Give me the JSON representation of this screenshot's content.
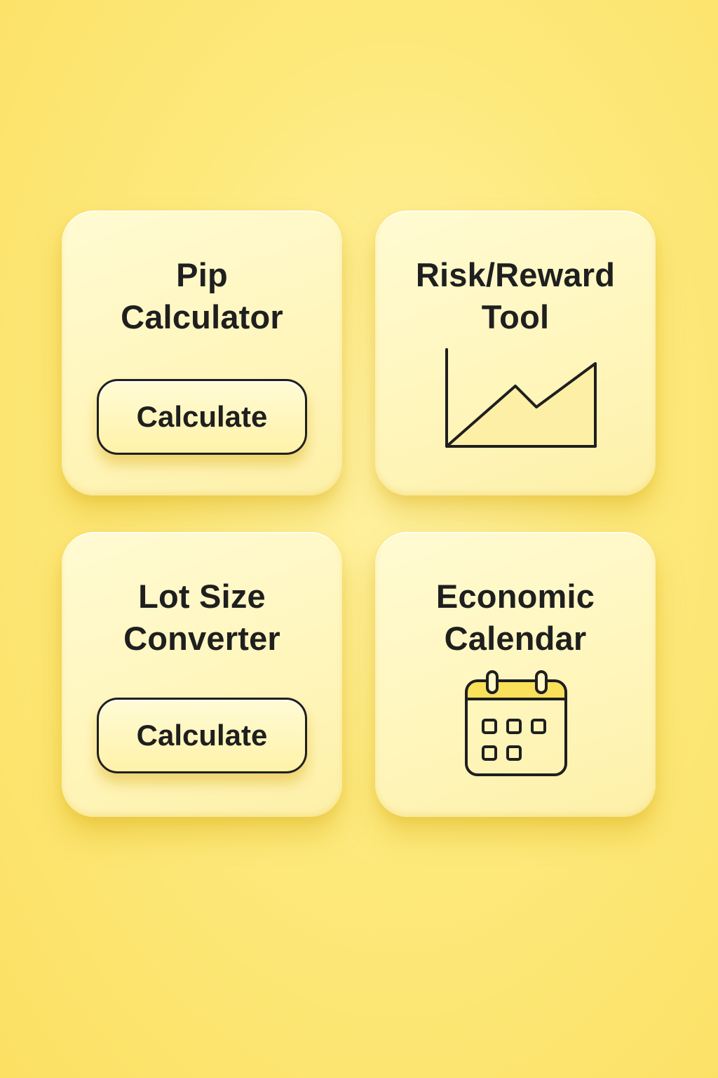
{
  "colors": {
    "background": "#fde97c",
    "card": "#fff6bd",
    "ink": "#1f1f1f",
    "accent_fill": "#fdefa0"
  },
  "cards": [
    {
      "title_lines": [
        "Pip",
        "Calculator"
      ],
      "button_label": "Calculate"
    },
    {
      "title_lines": [
        "Risk/Reward",
        "Tool"
      ],
      "icon": "area-chart-icon"
    },
    {
      "title_lines": [
        "Lot Size",
        "Converter"
      ],
      "button_label": "Calculate"
    },
    {
      "title_lines": [
        "Economic",
        "Calendar"
      ],
      "icon": "calendar-icon"
    }
  ]
}
